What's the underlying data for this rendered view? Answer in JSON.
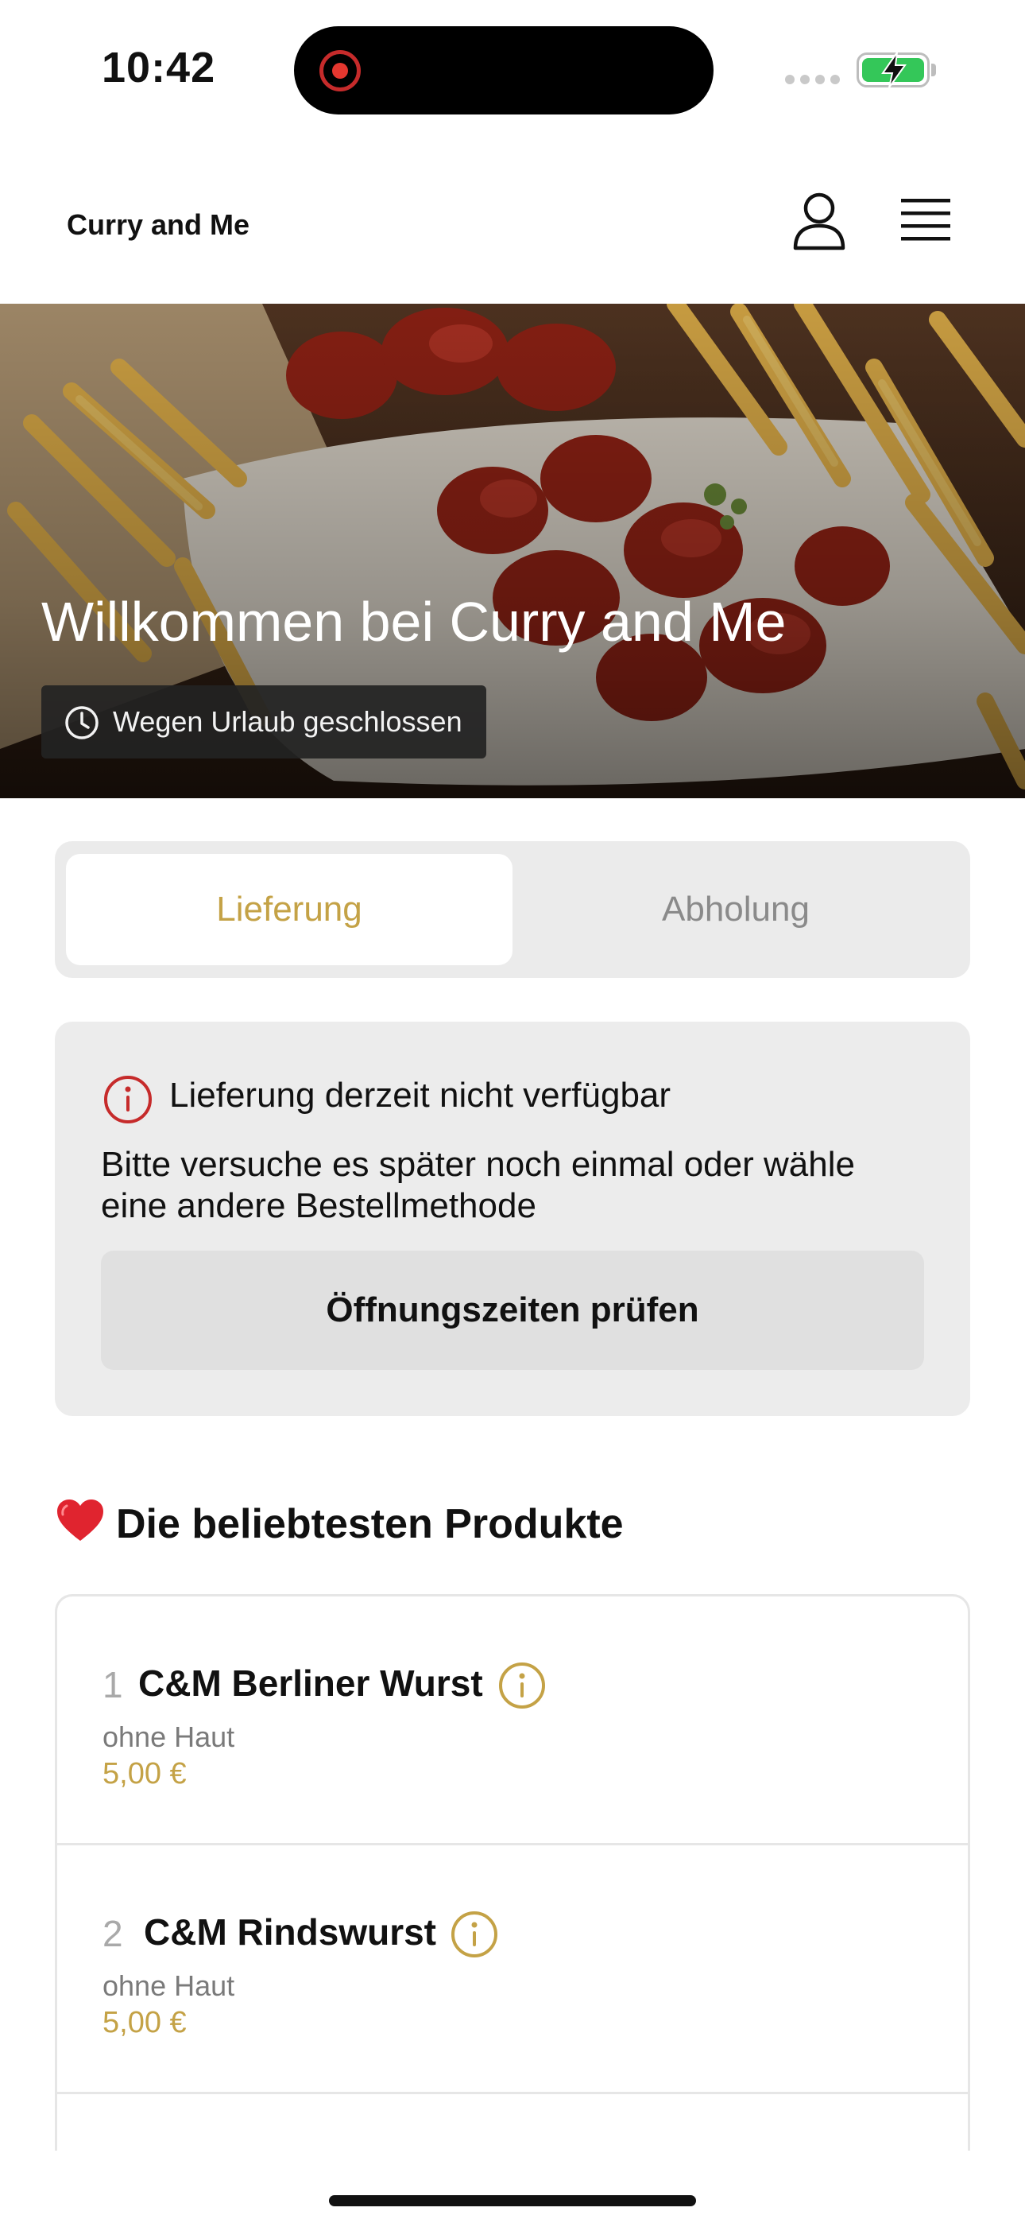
{
  "status_bar": {
    "time": "10:42"
  },
  "header": {
    "brand": "Curry and Me",
    "icons": {
      "account": "person-icon",
      "menu": "hamburger-menu-icon"
    }
  },
  "hero": {
    "title": "Willkommen bei Curry and Me",
    "badge": "Wegen Urlaub geschlossen",
    "badge_icon": "clock-icon"
  },
  "order_mode": {
    "tabs": [
      {
        "label": "Lieferung",
        "selected": true
      },
      {
        "label": "Abholung",
        "selected": false
      }
    ]
  },
  "notice": {
    "icon": "info-circle-icon",
    "title": "Lieferung derzeit nicht verfügbar",
    "text": "Bitte versuche es später noch einmal oder wähle eine andere Bestellmethode",
    "button_label": "Öffnungszeiten prüfen"
  },
  "popular": {
    "title": "Die beliebtesten Produkte",
    "icon": "heart-icon",
    "products": [
      {
        "rank": "1",
        "name": "C&M Berliner Wurst",
        "description": "ohne Haut",
        "price": "5,00 €"
      },
      {
        "rank": "2",
        "name": "C&M Rindswurst",
        "description": "ohne Haut",
        "price": "5,00 €"
      }
    ]
  },
  "colors": {
    "accent": "#c4a246",
    "alert": "#c62b2b",
    "card_background": "#ececec",
    "battery": "#34c759"
  }
}
